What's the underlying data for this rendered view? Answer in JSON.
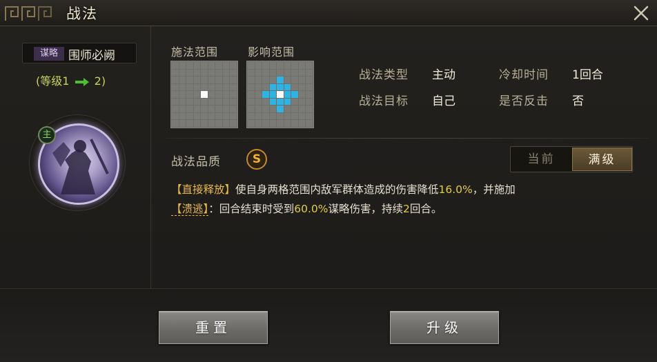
{
  "window": {
    "title": "战法"
  },
  "skill": {
    "type_tag": "谋略",
    "name": "围师必阙",
    "level_open": "(等级",
    "level_from": "1",
    "level_to": "2",
    "level_close": ")",
    "main_badge": "主"
  },
  "ranges": {
    "cast_label": "施法范围",
    "effect_label": "影响范围",
    "cast_cells_white": [
      40
    ],
    "effect_cells_white": [
      40
    ],
    "effect_cells_blue": [
      22,
      30,
      31,
      32,
      38,
      39,
      41,
      42,
      48,
      49,
      50,
      58
    ]
  },
  "info": {
    "type_label": "战法类型",
    "type_value": "主动",
    "cooldown_label": "冷却时间",
    "cooldown_value": "1回合",
    "target_label": "战法目标",
    "target_value": "自己",
    "counter_label": "是否反击",
    "counter_value": "否"
  },
  "quality": {
    "label": "战法品质",
    "grade": "S"
  },
  "tabs": {
    "current": "当前",
    "max": "满级",
    "selected": "max"
  },
  "description": {
    "line1": {
      "keyword": "【直接释放】",
      "text1": "使自身两格范围内敌军群体造成的伤害降低",
      "value1": "16.0%",
      "text2": "，并施加"
    },
    "line2": {
      "status": "【溃逃】",
      "text1": "：回合结束时受到",
      "value1": "60.0%",
      "text2": "谋略伤害，持续",
      "value2": "2",
      "text3": "回合。"
    }
  },
  "buttons": {
    "reset": "重置",
    "upgrade": "升级"
  },
  "colors": {
    "accent_gold": "#e9b94a",
    "range_blue": "#2fb3e2",
    "level_green": "#c9d357"
  }
}
